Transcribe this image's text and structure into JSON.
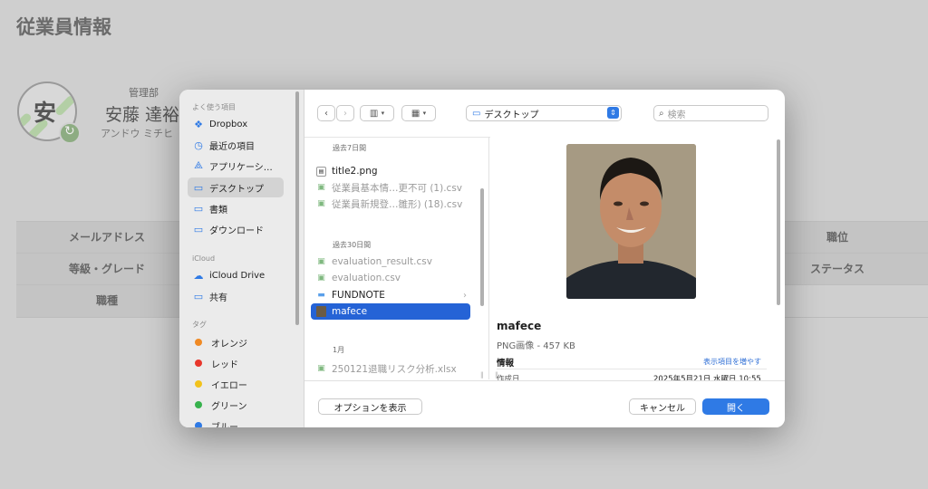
{
  "background": {
    "page_title": "従業員情報",
    "avatar_char": "安",
    "department": "管理部",
    "name": "安藤 達裕",
    "name_kana": "アンドウ ミチヒ",
    "table": {
      "row1": {
        "label1": "メールアドレス",
        "label2": "職位"
      },
      "row2": {
        "label1": "等級・グレード",
        "label2": "ステータス"
      },
      "row3": {
        "label1": "職種"
      }
    }
  },
  "dialog": {
    "sidebar": {
      "favorites_title": "よく使う項目",
      "favorites": [
        {
          "label": "Dropbox",
          "icon": "dropbox-icon"
        },
        {
          "label": "最近の項目",
          "icon": "clock-icon"
        },
        {
          "label": "アプリケーシ…",
          "icon": "apps-icon"
        },
        {
          "label": "デスクトップ",
          "icon": "folder-icon",
          "selected": true
        },
        {
          "label": "書類",
          "icon": "folder-icon"
        },
        {
          "label": "ダウンロード",
          "icon": "folder-icon"
        }
      ],
      "icloud_title": "iCloud",
      "icloud": [
        {
          "label": "iCloud Drive",
          "icon": "cloud-icon"
        },
        {
          "label": "共有",
          "icon": "shared-folder-icon"
        }
      ],
      "tags_title": "タグ",
      "tags": [
        {
          "label": "オレンジ",
          "color": "#f08a24"
        },
        {
          "label": "レッド",
          "color": "#e8372c"
        },
        {
          "label": "イエロー",
          "color": "#f2c21b"
        },
        {
          "label": "グリーン",
          "color": "#37b24d"
        },
        {
          "label": "ブルー",
          "color": "#2f7ae5"
        }
      ]
    },
    "toolbar": {
      "location": "デスクトップ",
      "search_placeholder": "検索"
    },
    "files": {
      "group1": "過去7日間",
      "group1_items": [
        {
          "name": "title2.png",
          "dim": false
        },
        {
          "name": "従業員基本情…更不可 (1).csv",
          "dim": true
        },
        {
          "name": "従業員新規登…雛形) (18).csv",
          "dim": true
        }
      ],
      "group2": "過去30日間",
      "group2_items": [
        {
          "name": "evaluation_result.csv",
          "dim": true
        },
        {
          "name": "evaluation.csv",
          "dim": true
        },
        {
          "name": "FUNDNOTE",
          "dim": false,
          "folder": true
        },
        {
          "name": "mafece",
          "dim": false,
          "selected": true
        }
      ],
      "group3": "1月",
      "group3_items": [
        {
          "name": "250121退職リスク分析.xlsx",
          "dim": true
        }
      ]
    },
    "preview": {
      "name": "mafece",
      "kind": "PNG画像 - 457 KB",
      "info_title": "情報",
      "show_more": "表示項目を増やす",
      "created_label": "作成日",
      "created_value": "2025年5月21日 水曜日 10:55"
    },
    "footer": {
      "options_label": "オプションを表示",
      "cancel_label": "キャンセル",
      "open_label": "開く"
    }
  }
}
